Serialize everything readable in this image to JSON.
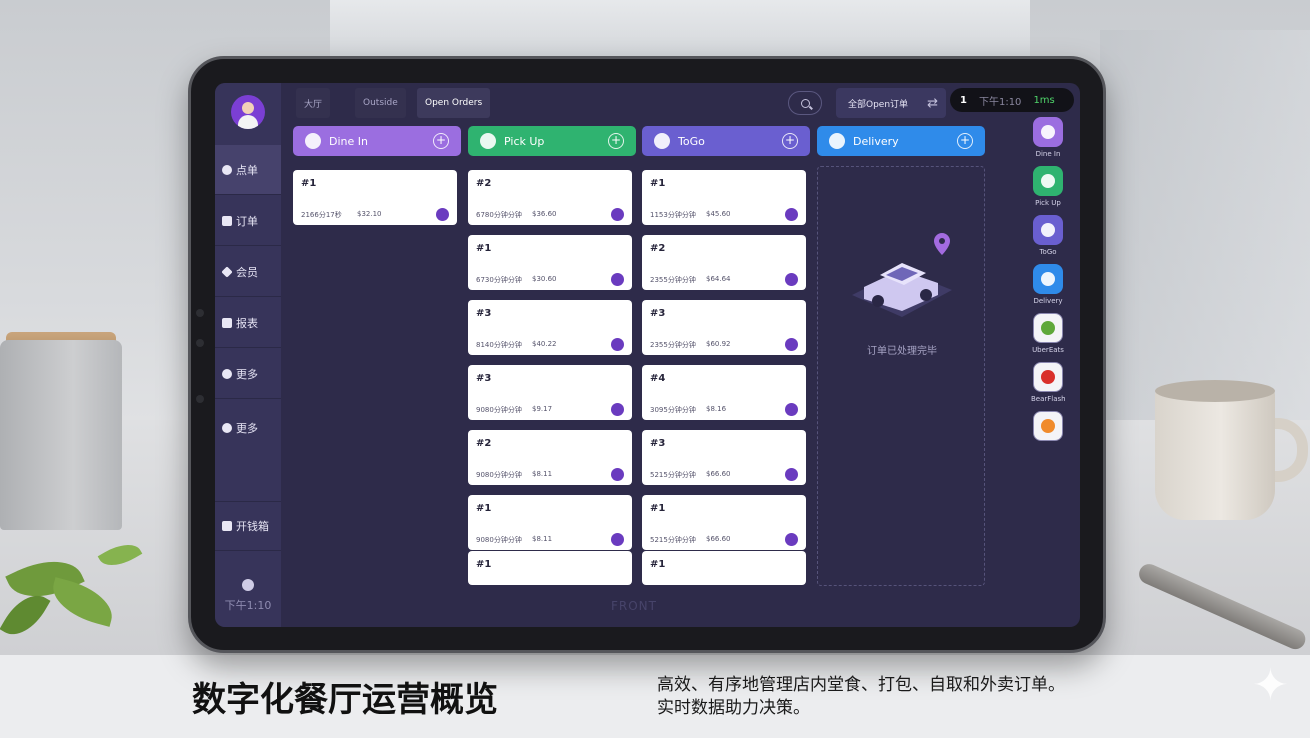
{
  "sidebar": {
    "items": [
      {
        "label": "点单",
        "icon": "hand-pointer-icon"
      },
      {
        "label": "订单",
        "icon": "receipt-icon"
      },
      {
        "label": "会员",
        "icon": "diamond-icon"
      },
      {
        "label": "报表",
        "icon": "chart-icon"
      },
      {
        "label": "更多",
        "icon": "gear-icon"
      },
      {
        "label": "更多",
        "icon": "gear-icon"
      },
      {
        "label": "开钱箱",
        "icon": "cash-drawer-icon"
      }
    ],
    "time": "下午1:10"
  },
  "topbar": {
    "tabs": [
      "大厅",
      "Outside",
      "Open Orders"
    ],
    "active_tab": "Open Orders",
    "open_orders_label": "全部Open订单",
    "status_count": "1",
    "status_time": "下午1:10",
    "status_latency": "1ms"
  },
  "columns": [
    {
      "title": "Dine In",
      "color": "#9b6ee0",
      "cards": [
        {
          "num": "#1",
          "meta": "2166分17秒",
          "price": "$32.10"
        }
      ]
    },
    {
      "title": "Pick Up",
      "color": "#2fb370",
      "cards": [
        {
          "num": "#2",
          "meta": "6780分钟分钟",
          "price": "$36.60"
        },
        {
          "num": "#1",
          "meta": "6730分钟分钟",
          "price": "$30.60"
        },
        {
          "num": "#3",
          "meta": "8140分钟分钟",
          "price": "$40.22"
        },
        {
          "num": "#3",
          "meta": "9080分钟分钟",
          "price": "$9.17"
        },
        {
          "num": "#2",
          "meta": "9080分钟分钟",
          "price": "$8.11"
        },
        {
          "num": "#1",
          "meta": "9080分钟分钟",
          "price": "$8.11"
        },
        {
          "num": "#1",
          "meta": "",
          "price": ""
        }
      ]
    },
    {
      "title": "ToGo",
      "color": "#6a5fd0",
      "cards": [
        {
          "num": "#1",
          "meta": "1153分钟分钟",
          "price": "$45.60"
        },
        {
          "num": "#2",
          "meta": "2355分钟分钟",
          "price": "$64.64"
        },
        {
          "num": "#3",
          "meta": "2355分钟分钟",
          "price": "$60.92"
        },
        {
          "num": "#4",
          "meta": "3095分钟分钟",
          "price": "$8.16"
        },
        {
          "num": "#3",
          "meta": "5215分钟分钟",
          "price": "$66.60"
        },
        {
          "num": "#1",
          "meta": "5215分钟分钟",
          "price": "$66.60"
        },
        {
          "num": "#1",
          "meta": "",
          "price": ""
        }
      ]
    },
    {
      "title": "Delivery",
      "color": "#2f8bea",
      "cards": [],
      "empty_message": "订单已处理完毕"
    }
  ],
  "watermark": "FRONT",
  "rail": [
    {
      "label": "Dine In",
      "color": "#9b6ee0",
      "icon": "dine-in-icon"
    },
    {
      "label": "Pick Up",
      "color": "#2fb370",
      "icon": "pickup-bag-icon"
    },
    {
      "label": "ToGo",
      "color": "#6a5fd0",
      "icon": "togo-walk-icon"
    },
    {
      "label": "Delivery",
      "color": "#2f8bea",
      "icon": "delivery-icon"
    },
    {
      "label": "UberEats",
      "color": "#ffffff",
      "icon": "ubereats-icon"
    },
    {
      "label": "BearFlash",
      "color": "#ffffff",
      "icon": "bearflash-icon"
    },
    {
      "label": "",
      "color": "#ffffff",
      "icon": "home-icon"
    }
  ],
  "caption": {
    "title": "数字化餐厅运营概览",
    "line1": "高效、有序地管理店内堂食、打包、自取和外卖订单。",
    "line2": "实时数据助力决策。"
  }
}
